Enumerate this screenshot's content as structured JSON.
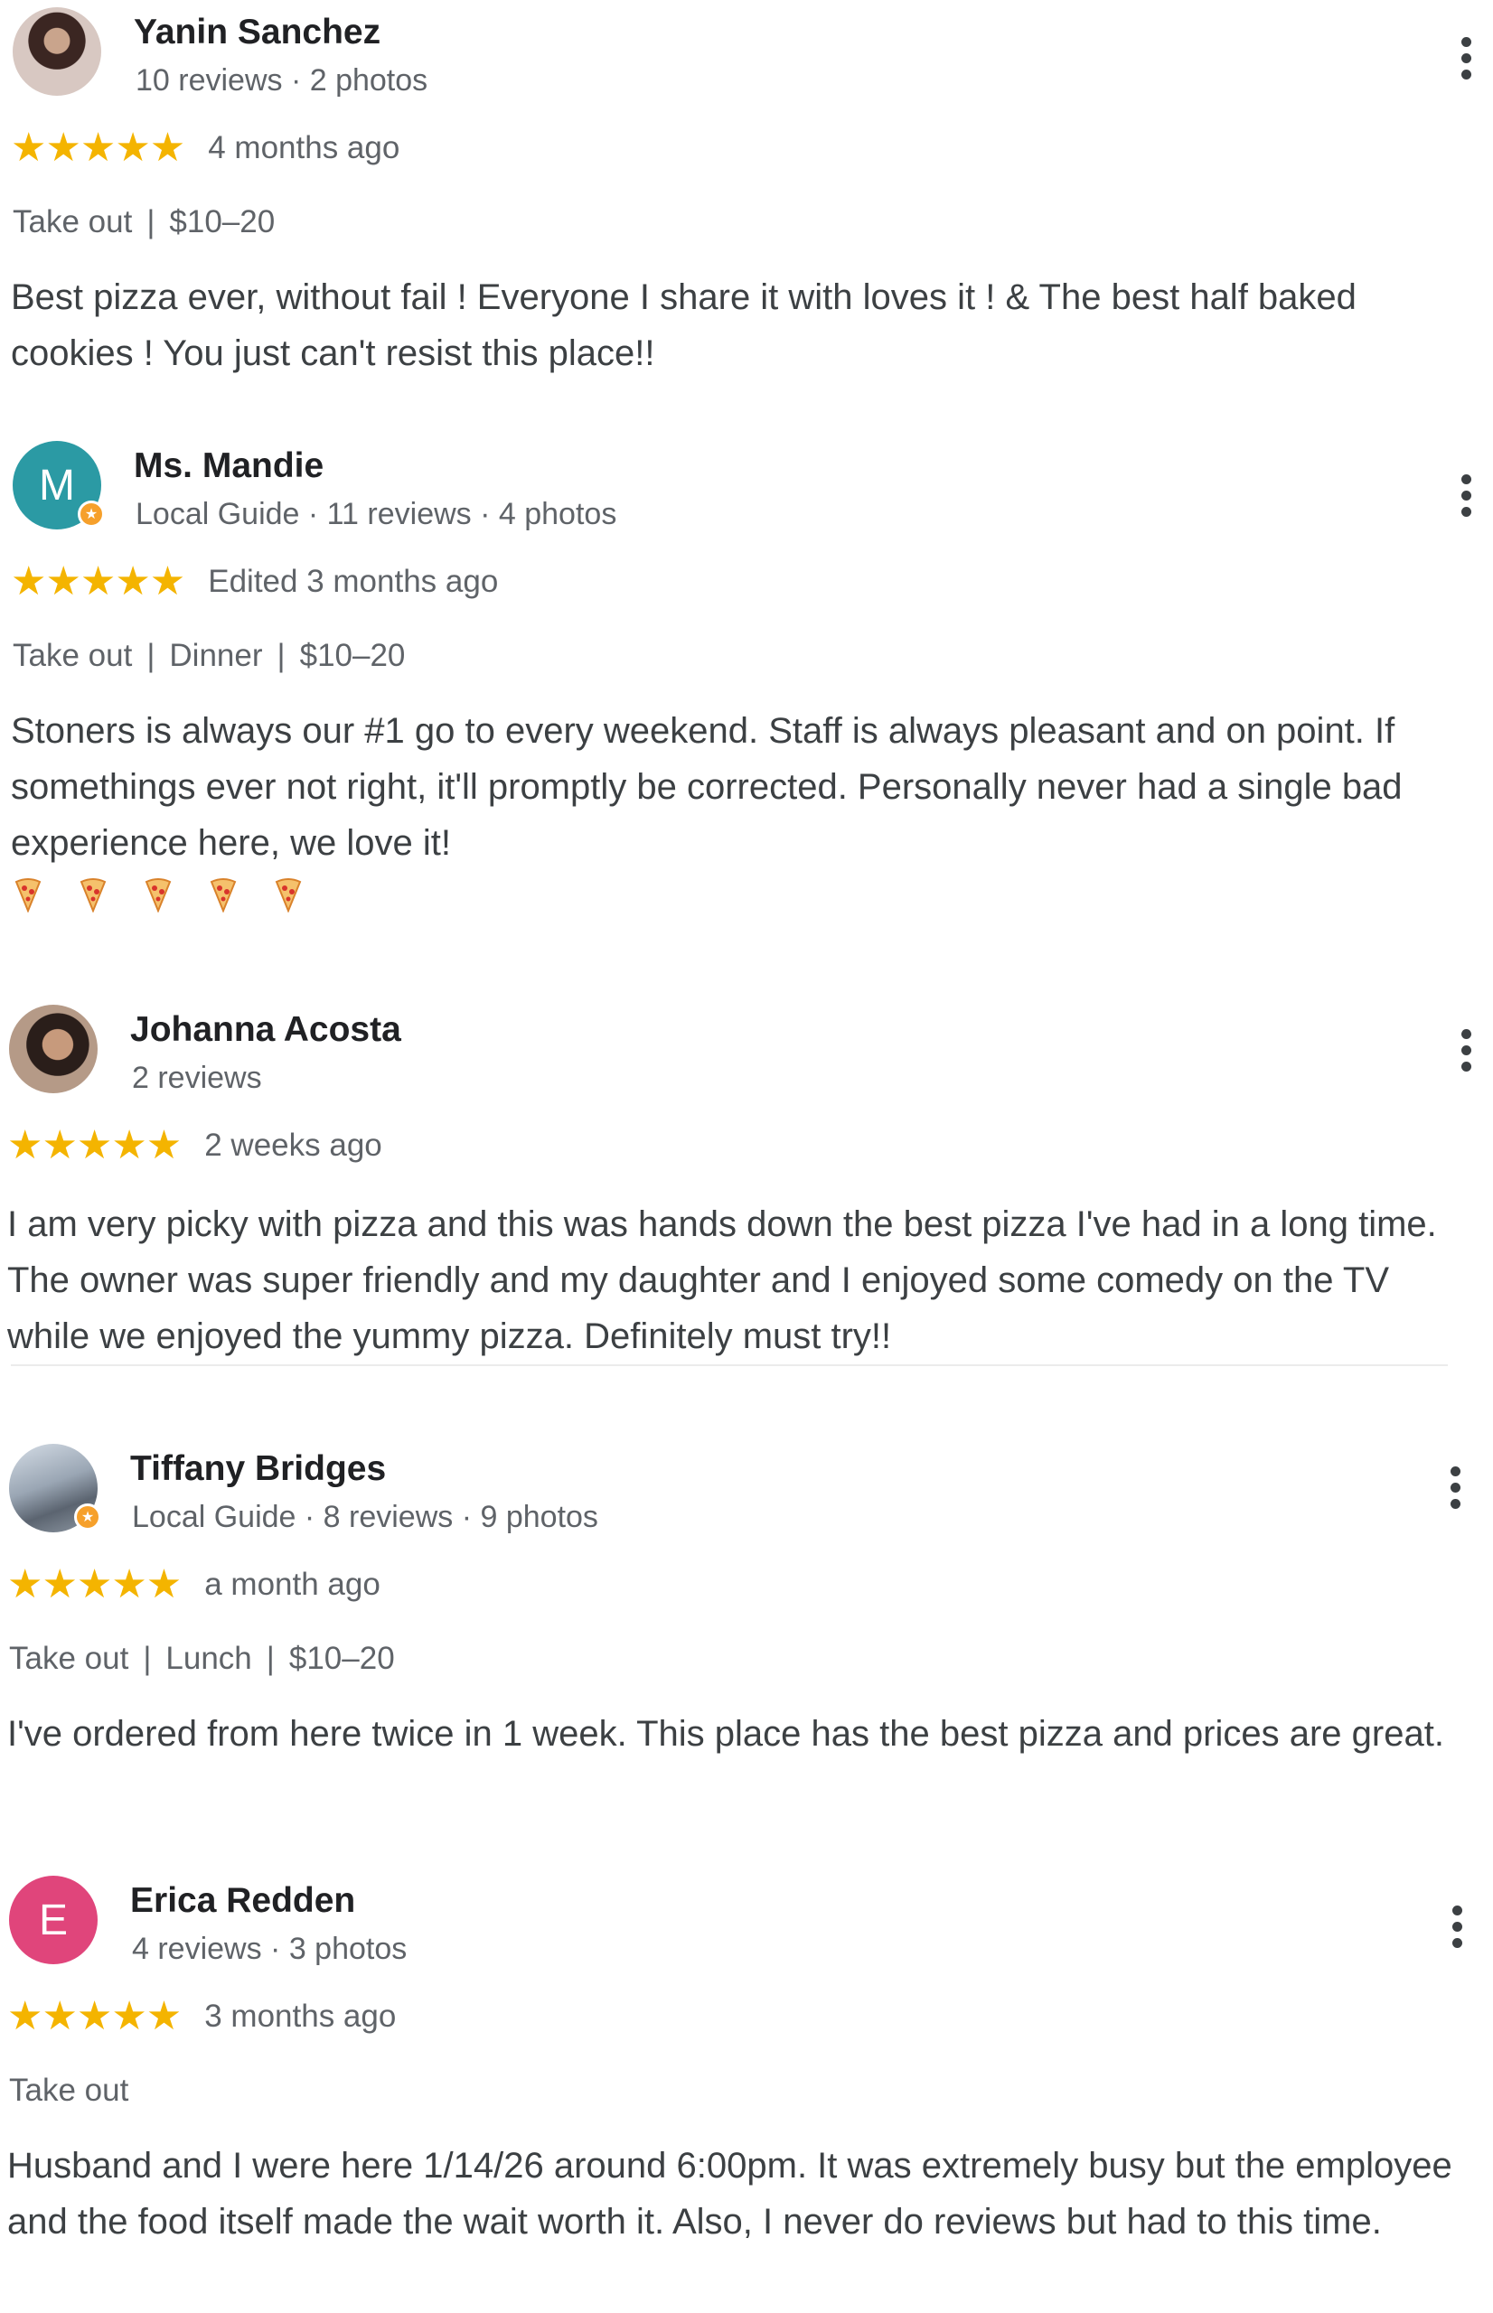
{
  "reviews": [
    {
      "name": "Yanin Sanchez",
      "meta": "10 reviews · 2 photos",
      "stars": "★★★★★",
      "date": "4 months ago",
      "attrs": [
        "Take out",
        "$10–20"
      ],
      "text": "Best pizza ever, without fail ! Everyone I share it with loves it ! & The best half baked cookies ! You just can't resist this place!!",
      "avatar": {
        "type": "photo",
        "color": "#5a3a3a"
      }
    },
    {
      "name": "Ms. Mandie",
      "meta": "Local Guide · 11 reviews · 4 photos",
      "stars": "★★★★★",
      "date": "Edited 3 months ago",
      "attrs": [
        "Take out",
        "Dinner",
        "$10–20"
      ],
      "text": "Stoners is always our #1 go to every weekend. Staff is always pleasant and on point. If somethings ever not right, it'll promptly be corrected. Personally never had a single bad experience here, we love it!",
      "emoji": [
        "pizza",
        "pizza",
        "pizza",
        "pizza",
        "pizza"
      ],
      "avatar": {
        "type": "letter",
        "letter": "M",
        "color": "#2b9aa4"
      }
    },
    {
      "name": "Johanna Acosta",
      "meta": "2 reviews",
      "stars": "★★★★★",
      "date": "2 weeks ago",
      "text": "I am very picky with pizza and this was hands down the best pizza I've had in a long time. The owner was super friendly and my daughter and I enjoyed some comedy on the TV while we enjoyed the yummy pizza. Definitely must try!!",
      "avatar": {
        "type": "photo",
        "color": "#8b6a52"
      }
    },
    {
      "name": "Tiffany Bridges",
      "meta": "Local Guide · 8 reviews · 9 photos",
      "stars": "★★★★★",
      "date": "a month ago",
      "attrs": [
        "Take out",
        "Lunch",
        "$10–20"
      ],
      "text": "I've ordered from here twice in 1 week. This place has the best pizza and prices are great.",
      "avatar": {
        "type": "photo",
        "color": "#7b8899"
      }
    },
    {
      "name": "Erica Redden",
      "meta": "4 reviews · 3 photos",
      "stars": "★★★★★",
      "date": "3 months ago",
      "attrs": [
        "Take out"
      ],
      "text": "Husband and I were here 1/14/26 around 6:00pm. It was extremely busy but the employee and the food itself made the wait worth it. Also, I never do reviews but had to this time.",
      "avatar": {
        "type": "letter",
        "letter": "E",
        "color": "#e0457b"
      }
    }
  ]
}
